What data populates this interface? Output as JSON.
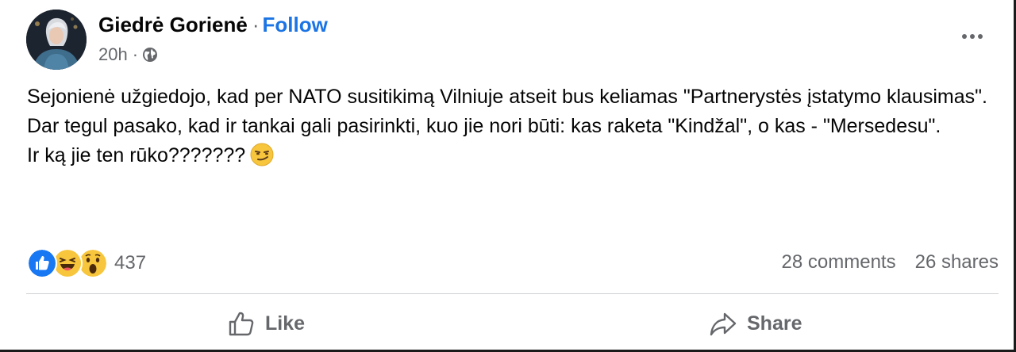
{
  "post": {
    "author": "Giedrė Gorienė",
    "separator": "·",
    "follow_label": "Follow",
    "time": "20h",
    "meta_separator": "·",
    "privacy_icon": "globe-icon",
    "paragraphs": [
      "Sejonienė užgiedojo, kad per NATO susitikimą Vilniuje atseit bus keliamas \"Partnerystės įstatymo klausimas\".",
      "Dar tegul pasako, kad ir tankai gali pasirinkti, kuo jie nori būti: kas raketa \"Kindžal\", o kas - \"Mersedesu\".",
      "Ir ką jie ten rūko???????"
    ],
    "trailing_emoji": "smirking-face-emoji"
  },
  "reactions": {
    "icons": [
      "like-reaction-icon",
      "haha-reaction-icon",
      "wow-reaction-icon"
    ],
    "count": "437"
  },
  "stats": {
    "comments": "28 comments",
    "shares": "26 shares"
  },
  "actions": {
    "like_label": "Like",
    "share_label": "Share"
  },
  "colors": {
    "accent": "#1b74e4",
    "secondary_text": "#65676b",
    "divider": "#ced0d4"
  }
}
